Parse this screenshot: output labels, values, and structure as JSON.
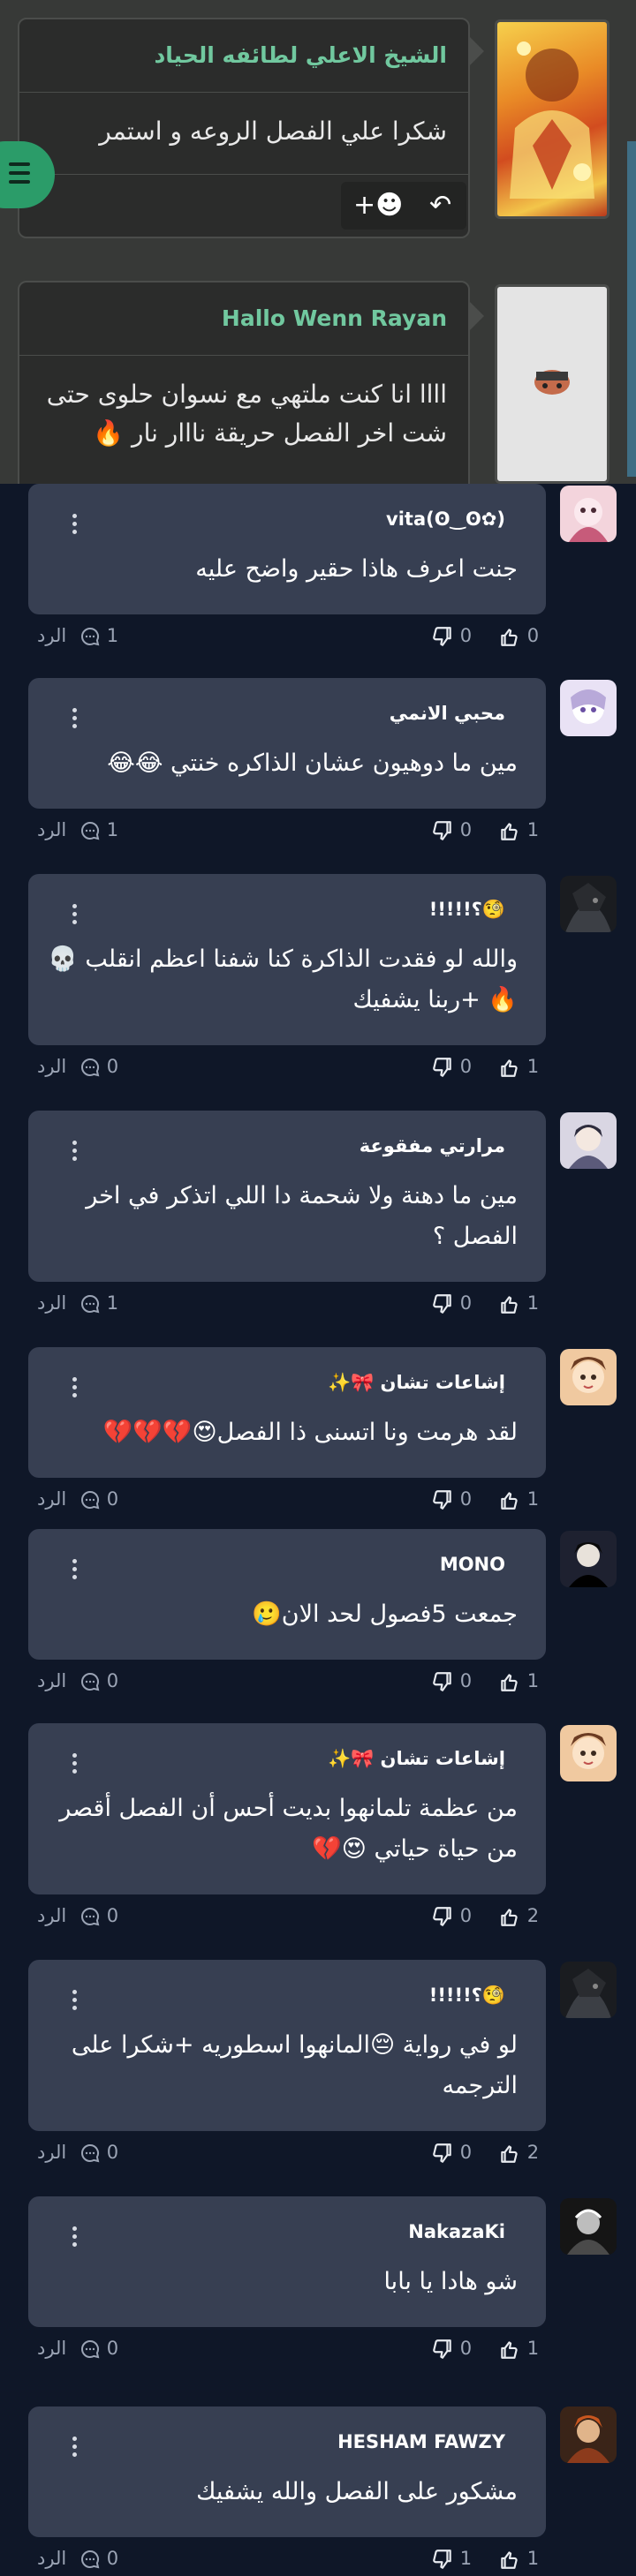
{
  "palette": {
    "accent": "#71c89f",
    "page_bg": "#0f1728",
    "card_bg": "#373f52",
    "muted": "#9ba4b5",
    "fab": "#2b9c69"
  },
  "previous_comments": [
    {
      "name": "الشيخ الاعلي لطائفه الحياد",
      "text": "شكرا علي الفصل الروعه و استمر",
      "add_reaction_icon": "smiley-plus-icon",
      "reply_icon": "reply-arrow-icon"
    },
    {
      "name": "Hallo Wenn Rayan",
      "text": "اااا انا كنت ملتهي مع نسوان حلوى حتى شت اخر الفصل حريقة نااار نار 🔥"
    }
  ],
  "menu_button": {
    "icon": "hamburger-menu-icon"
  },
  "comments": [
    {
      "name": "vita(ʘ‿ʘ✿)",
      "text": "جنت اعرف هاذا حقير واضح عليه",
      "likes": "0",
      "dislikes": "0",
      "replies": "1",
      "reply_label": "الرد"
    },
    {
      "name": "محبي الانمي",
      "text": "مين ما دوهيون عشان الذاكره خنتي 😂😂",
      "likes": "1",
      "dislikes": "0",
      "replies": "1",
      "reply_label": "الرد"
    },
    {
      "name": "🧐؟!!!!!",
      "text": "والله لو فقدت الذاكرة كنا شفنا اعظم انقلب 💀 🔥 +ربنا يشفيك",
      "likes": "1",
      "dislikes": "0",
      "replies": "0",
      "reply_label": "الرد"
    },
    {
      "name": "مرارتي مفقوعة",
      "text": "مين ما دهنة ولا شحمة دا اللي اتذكر في اخر الفصل ؟",
      "likes": "1",
      "dislikes": "0",
      "replies": "1",
      "reply_label": "الرد"
    },
    {
      "name": "إشاعات تشان 🎀✨",
      "text": "لقد هرمت ونا اتسنى ذا الفصل😍💔💔💔",
      "likes": "1",
      "dislikes": "0",
      "replies": "0",
      "reply_label": "الرد"
    },
    {
      "name": "MONO",
      "text": "جمعت 5فصول لحد الان🥲",
      "likes": "1",
      "dislikes": "0",
      "replies": "0",
      "reply_label": "الرد"
    },
    {
      "name": "إشاعات تشان 🎀✨",
      "text": "من عظمة تلمانهوا بديت أحس أن الفصل أقصر من حياة حياتي 😍💔",
      "likes": "2",
      "dislikes": "0",
      "replies": "0",
      "reply_label": "الرد"
    },
    {
      "name": "🧐؟!!!!!",
      "text": "لو في رواية 😔المانهوا اسطوريه +شكرا على الترجمه",
      "likes": "2",
      "dislikes": "0",
      "replies": "0",
      "reply_label": "الرد"
    },
    {
      "name": "NakazaKi",
      "text": "شو هادا يا بابا",
      "likes": "1",
      "dislikes": "0",
      "replies": "0",
      "reply_label": "الرد"
    },
    {
      "name": "HESHAM FAWZY",
      "text": "مشكور على الفصل والله يشفيك",
      "likes": "1",
      "dislikes": "1",
      "replies": "0",
      "reply_label": "الرد"
    }
  ],
  "icons": {
    "like": "thumbs-up-icon",
    "dislike": "thumbs-down-icon",
    "reply": "chat-bubble-icon",
    "more": "kebab-menu-icon"
  }
}
